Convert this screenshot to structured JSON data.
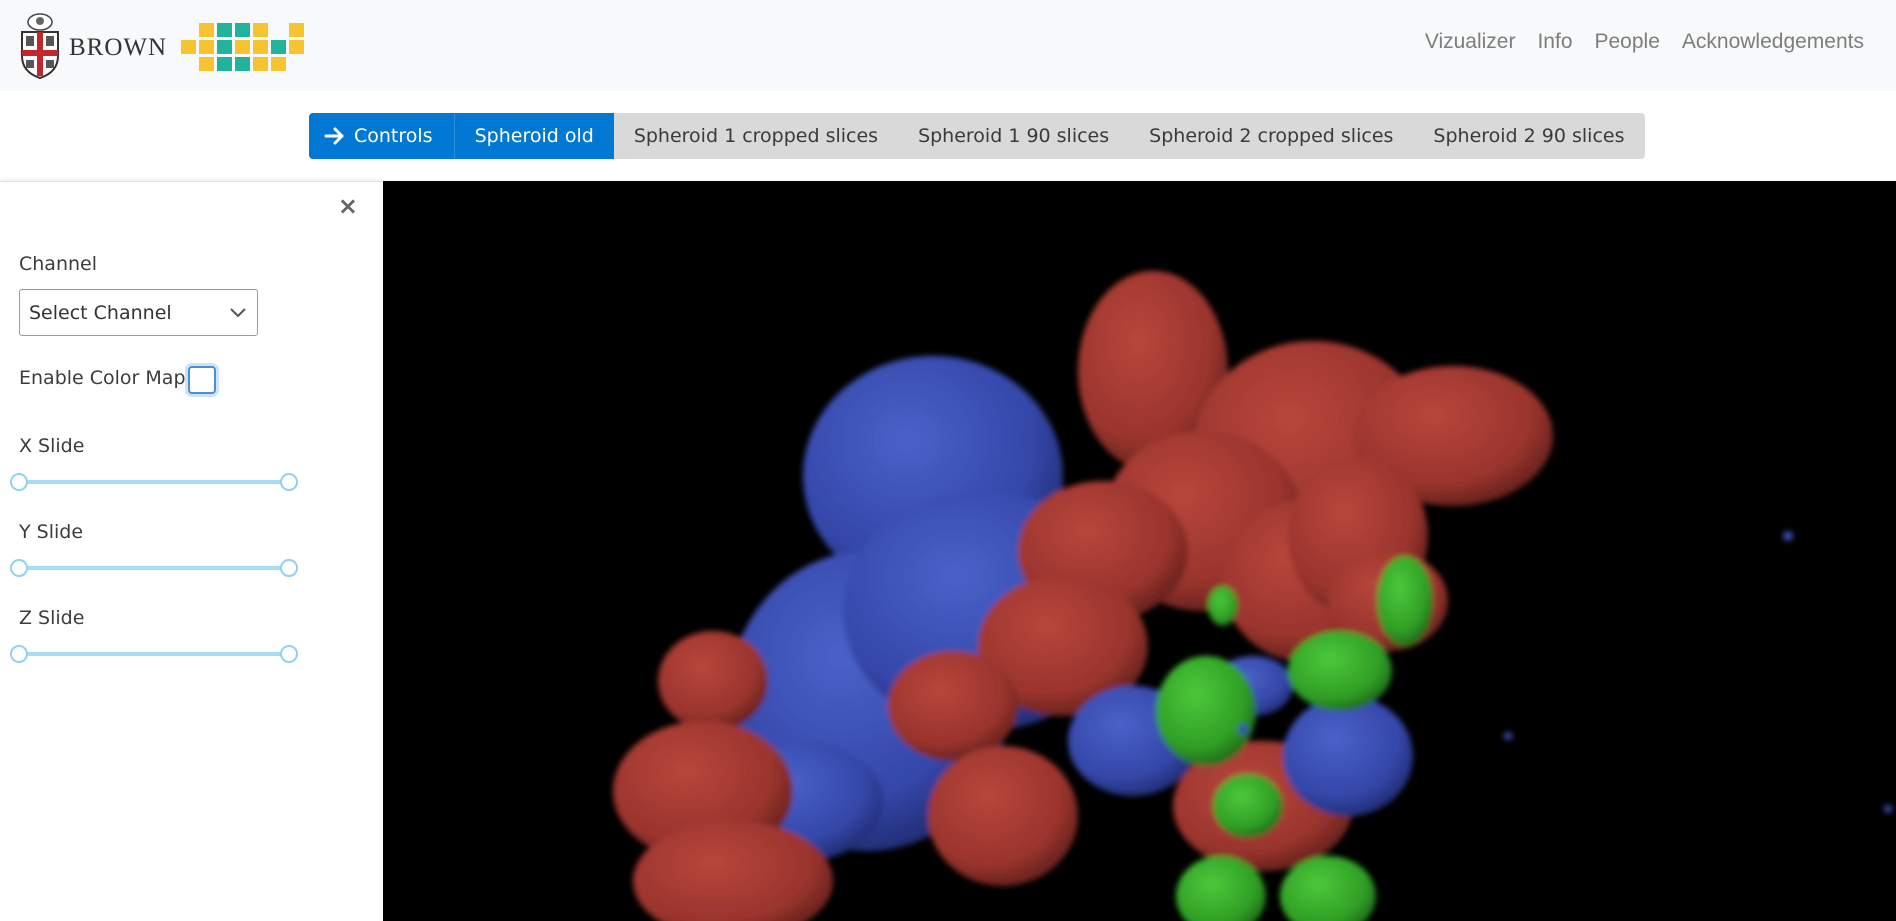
{
  "brand": {
    "wordmark": "BROWN",
    "crest": "brown-crest-icon",
    "pixel_logo": "pixel-logo-icon",
    "colors": {
      "yellow": "#f7c431",
      "teal": "#21b39b"
    }
  },
  "nav": {
    "links": [
      "Vizualizer",
      "Info",
      "People",
      "Acknowledgements"
    ]
  },
  "tabs": {
    "controls_label": "Controls",
    "controls_icon": "arrow-right-icon",
    "items": [
      "Spheroid old",
      "Spheroid 1 cropped slices",
      "Spheroid 1 90 slices",
      "Spheroid 2 cropped slices",
      "Spheroid 2 90 slices"
    ],
    "active_index": 0,
    "accent": "#0078d4"
  },
  "panel": {
    "close_glyph": "×",
    "channel_label": "Channel",
    "channel_select": "Select Channel",
    "colormap_label": "Enable Color Map",
    "colormap_checked": false,
    "sliders": [
      {
        "label": "X Slide",
        "min": 0,
        "max": 1
      },
      {
        "label": "Y Slide",
        "min": 0,
        "max": 1
      },
      {
        "label": "Z Slide",
        "min": 0,
        "max": 1
      }
    ]
  },
  "viewer": {
    "content": "3d-volume-render",
    "colors": {
      "background": "#000000",
      "red": "#a63a33",
      "blue": "#3a4fb5",
      "green": "#35b02a"
    }
  }
}
